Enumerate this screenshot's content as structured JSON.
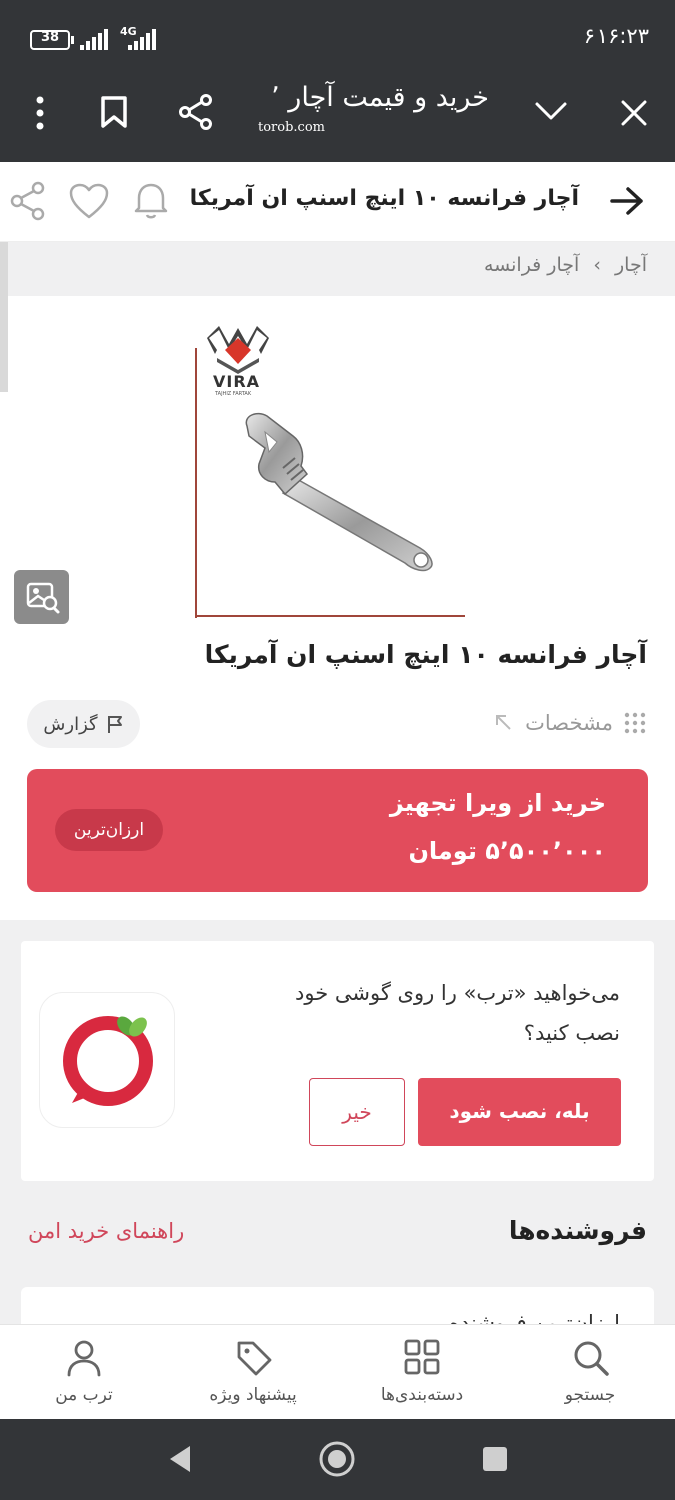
{
  "status_bar": {
    "time": "۱۶:۲۳",
    "notification_count": "۶",
    "network": "4G",
    "battery": "38"
  },
  "browser": {
    "page_title": "خرید و قیمت آچار ٬",
    "domain": "torob.com"
  },
  "header": {
    "title": "آچار فرانسه ۱۰ اینچ اسنپ ان آمریکا"
  },
  "breadcrumb": {
    "items": [
      "آچار",
      "آچار فرانسه"
    ],
    "separator": "›"
  },
  "product": {
    "logo_brand": "VIRA",
    "logo_sub": "TAJHIZ FARTAK",
    "name": "آچار فرانسه ۱۰ اینچ اسنپ ان آمریکا",
    "specs_label": "مشخصات",
    "report_label": "گزارش"
  },
  "offer": {
    "seller_line": "خرید از ویرا تجهیز",
    "price_line": "۵٬۵۰۰٬۰۰۰ تومان",
    "badge": "ارزان‌ترین",
    "color": "#e24c5c"
  },
  "install_prompt": {
    "question_line1": "می‌خواهید «ترب» را روی گوشی خود",
    "question_line2": "نصب کنید؟",
    "yes_label": "بله، نصب شود",
    "no_label": "خیر"
  },
  "sellers": {
    "title": "فروشنده‌ها",
    "guide_link": "راهنمای خرید امن",
    "partial_text": "ارزان‌ترین فروشنده"
  },
  "bottom_nav": {
    "items": [
      {
        "label": "جستجو",
        "icon": "search-icon"
      },
      {
        "label": "دسته‌بندی‌ها",
        "icon": "grid-icon"
      },
      {
        "label": "پیشنهاد ویژه",
        "icon": "tag-icon"
      },
      {
        "label": "ترب من",
        "icon": "user-icon"
      }
    ]
  },
  "colors": {
    "brand_red": "#e24c5c",
    "dark_bar": "#333538"
  }
}
